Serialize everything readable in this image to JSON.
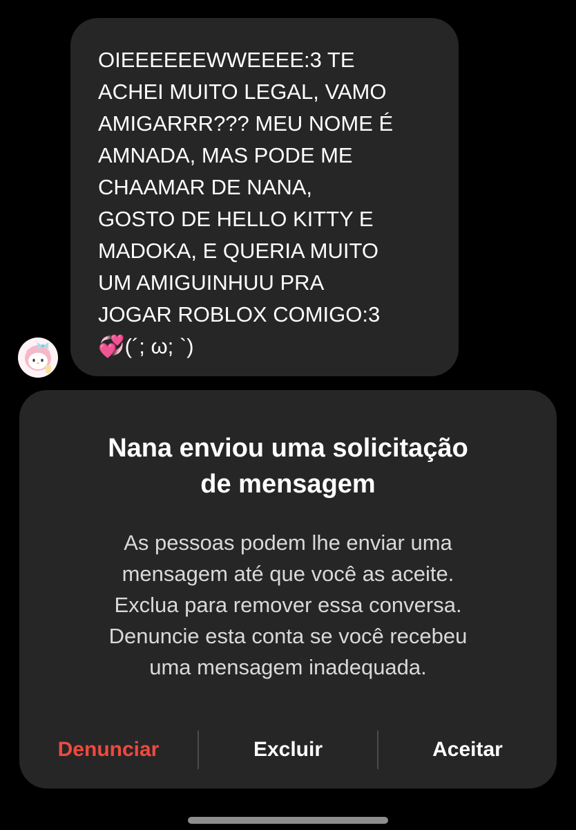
{
  "message": {
    "sender_avatar": "avatar-my-melody-icon",
    "text": "OIEEEEEEWWEEEE:3 TE\nACHEI MUITO LEGAL, VAMO\nAMIGARRR??? MEU NOME É\nAMNADA, MAS PODE ME\nCHAAMAR DE NANA,\nGOSTO DE HELLO KITTY E\nMADOKA, E QUERIA MUITO\nUM AMIGUINHUU PRA\nJOGAR ROBLOX COMIGO:3\n💞(´; ω; `)"
  },
  "request_card": {
    "title": "Nana enviou uma solicitação\nde mensagem",
    "description": "As pessoas podem lhe enviar uma\nmensagem até que você as aceite.\nExclua para remover essa conversa.\nDenuncie esta conta se você recebeu\numa mensagem inadequada.",
    "actions": {
      "report": "Denunciar",
      "delete": "Excluir",
      "accept": "Aceitar"
    }
  },
  "colors": {
    "background": "#000000",
    "surface": "#262626",
    "report_red": "#ef4a3f",
    "text_primary": "#ffffff",
    "text_secondary": "#d9d9d9"
  }
}
